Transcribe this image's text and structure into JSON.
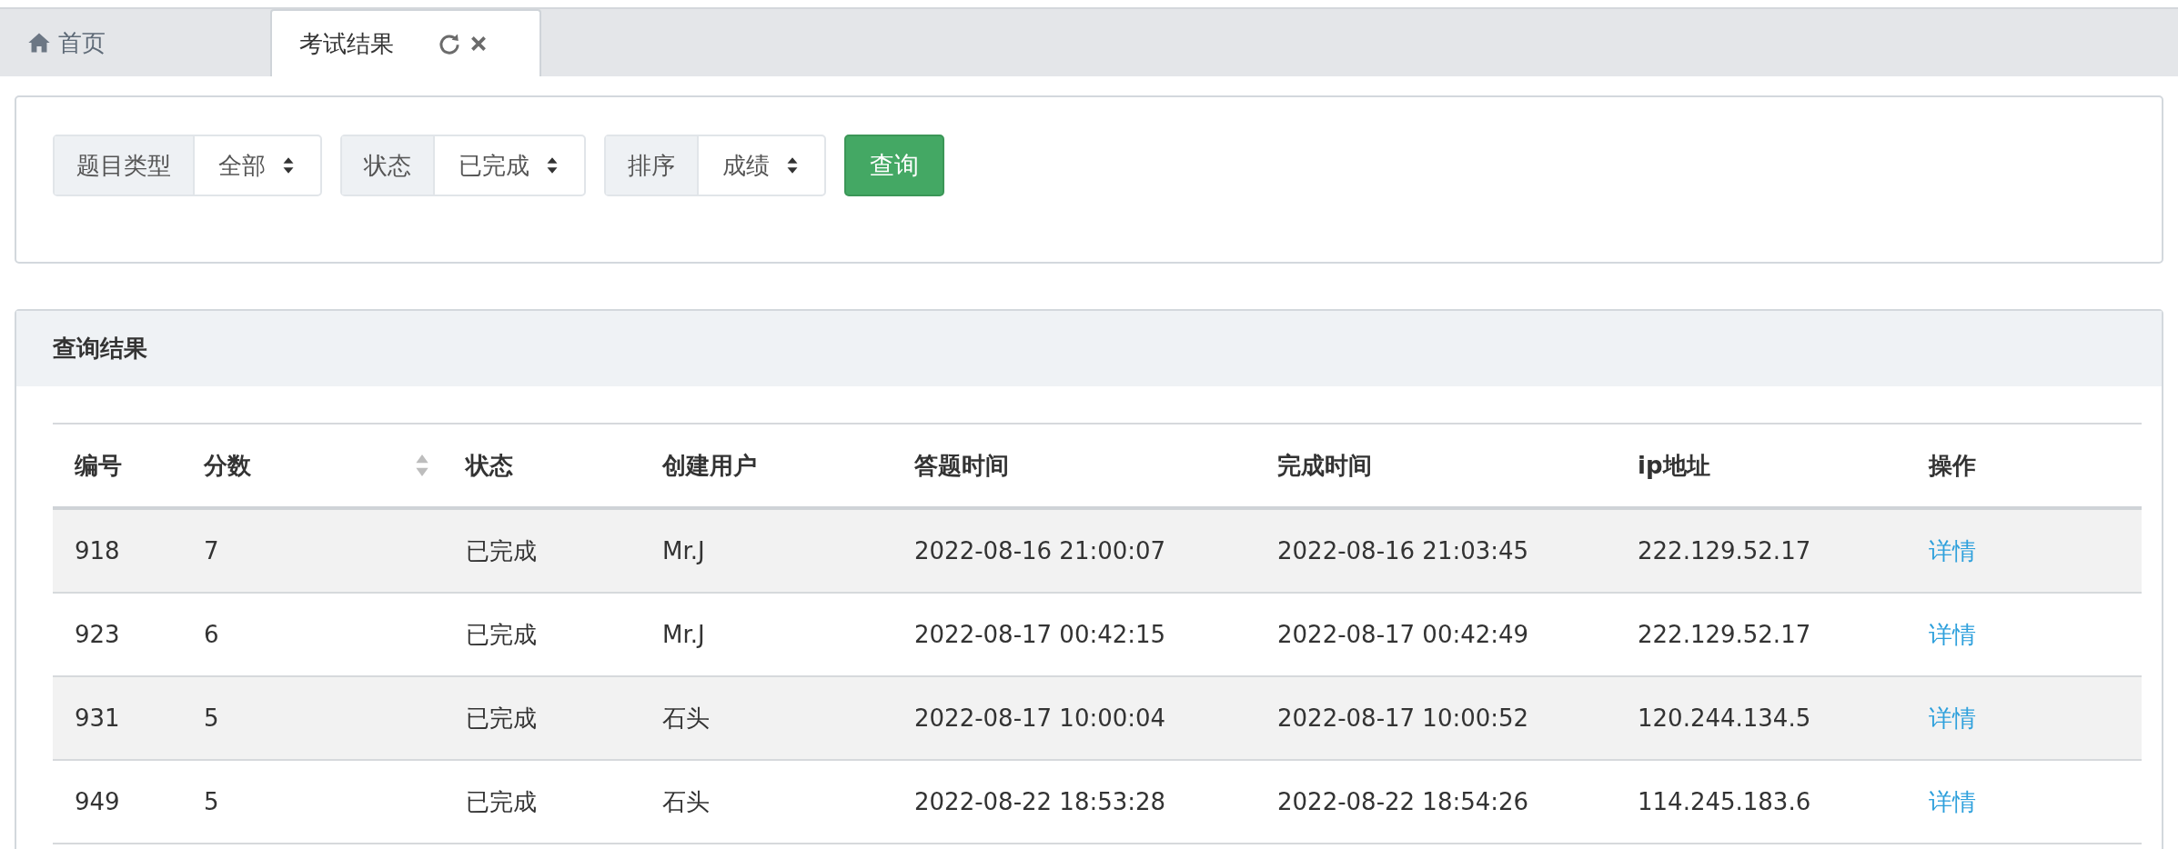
{
  "tabs": [
    {
      "label": "首页",
      "kind": "home",
      "selected": false
    },
    {
      "label": "考试结果",
      "kind": "page",
      "selected": true
    }
  ],
  "filters": [
    {
      "label": "题目类型",
      "value": "全部"
    },
    {
      "label": "状态",
      "value": "已完成"
    },
    {
      "label": "排序",
      "value": "成绩"
    }
  ],
  "query_button": "查询",
  "results": {
    "title": "查询结果",
    "columns": [
      {
        "label": "编号",
        "sortable": false
      },
      {
        "label": "分数",
        "sortable": true
      },
      {
        "label": "状态",
        "sortable": false
      },
      {
        "label": "创建用户",
        "sortable": false
      },
      {
        "label": "答题时间",
        "sortable": false
      },
      {
        "label": "完成时间",
        "sortable": false
      },
      {
        "label": "ip地址",
        "sortable": false
      },
      {
        "label": "操作",
        "sortable": false
      }
    ],
    "rows": [
      {
        "cells": [
          "918",
          "7",
          "已完成",
          "Mr.J",
          "2022-08-16 21:00:07",
          "2022-08-16 21:03:45",
          "222.129.52.17"
        ],
        "action": "详情"
      },
      {
        "cells": [
          "923",
          "6",
          "已完成",
          "Mr.J",
          "2022-08-17 00:42:15",
          "2022-08-17 00:42:49",
          "222.129.52.17"
        ],
        "action": "详情"
      },
      {
        "cells": [
          "931",
          "5",
          "已完成",
          "石头",
          "2022-08-17 10:00:04",
          "2022-08-17 10:00:52",
          "120.244.134.5"
        ],
        "action": "详情"
      },
      {
        "cells": [
          "949",
          "5",
          "已完成",
          "石头",
          "2022-08-22 18:53:28",
          "2022-08-22 18:54:26",
          "114.245.183.6"
        ],
        "action": "详情"
      }
    ]
  }
}
